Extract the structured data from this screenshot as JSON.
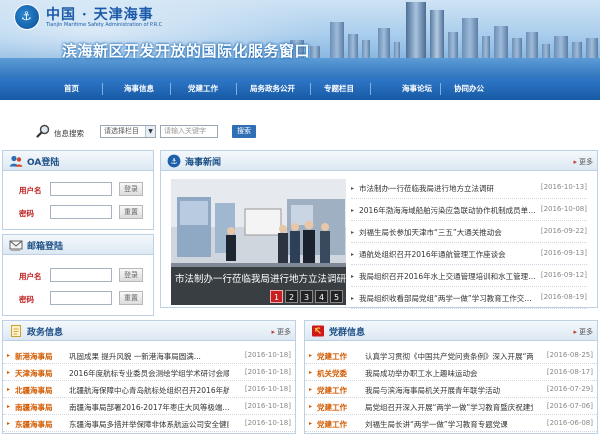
{
  "header": {
    "site_title": "中国 · 天津海事",
    "site_subtitle": "Tianjin Maritime Safety Administration of P.R.C",
    "slogan": "滨海新区开发开放的国际化服务窗口"
  },
  "nav": {
    "items": [
      {
        "label": "首页"
      },
      {
        "label": "海事信息"
      },
      {
        "label": "党建工作"
      },
      {
        "label": "局务政务公开"
      },
      {
        "label": "专题栏目"
      },
      {
        "label": "海事论坛"
      },
      {
        "label": "协同办公"
      }
    ]
  },
  "search": {
    "label": "信息搜索",
    "select_value": "请选择栏目",
    "keyword_placeholder": "请输入关键字",
    "button": "搜索"
  },
  "oa_login": {
    "title": "OA登陆",
    "username_label": "用户名",
    "password_label": "密码",
    "login_button": "登录",
    "reset_button": "重置"
  },
  "mail_login": {
    "title": "邮箱登陆",
    "username_label": "用户名",
    "password_label": "密码",
    "login_button": "登录",
    "reset_button": "重置"
  },
  "news": {
    "title": "海事新闻",
    "more": "更多",
    "slide_caption": "市法制办一行莅临我局进行地方立法调研",
    "pager": [
      "1",
      "2",
      "3",
      "4",
      "5"
    ],
    "pager_active": 1,
    "items": [
      {
        "title": "市法制办一行莅临我局进行地方立法调研",
        "date": "[2016-10-13]"
      },
      {
        "title": "2016年渤海海域船舶污染应急联动协作机制成员单位...",
        "date": "[2016-10-08]"
      },
      {
        "title": "刘福生局长参加天津市“三五”大通关推动会",
        "date": "[2016-09-22]"
      },
      {
        "title": "通航处组织召开2016年通航管理工作座谈会",
        "date": "[2016-09-13]"
      },
      {
        "title": "我局组织召开2016年水上交通管理培训和水工管理技能比...",
        "date": "[2016-09-12]"
      },
      {
        "title": "我局组织收看部局党组“两学一做”学习教育工作交流推...",
        "date": "[2016-08-19]"
      }
    ]
  },
  "gov_info": {
    "title": "政务信息",
    "more": "更多",
    "items": [
      {
        "tag": "新港海事局",
        "title": "巩固成果 提升风貌 一新港海事局圆满...",
        "date": "[2016-10-18]"
      },
      {
        "tag": "天津海事局",
        "title": "2016年度航标专业委员会测绘学组学术研讨会顺利...",
        "date": "[2016-10-18]"
      },
      {
        "tag": "北疆海事局",
        "title": "北疆航海保障中心青岛航标处组织召开2016年航标...",
        "date": "[2016-10-18]"
      },
      {
        "tag": "南疆海事局",
        "title": "南疆海事局部署2016-2017年枣庄大风等极端...",
        "date": "[2016-10-18]"
      },
      {
        "tag": "东疆海事局",
        "title": "东疆海事局多措并举保障非体系航运公司安全健康发展",
        "date": "[2016-10-18]"
      }
    ]
  },
  "party_info": {
    "title": "党群信息",
    "more": "更多",
    "items": [
      {
        "tag": "党建工作",
        "title": "认真学习贯彻《中国共产党问责条例》深入开展“两学...",
        "date": "[2016-08-25]"
      },
      {
        "tag": "机关党委",
        "title": "我局成功举办职工水上趣味运动会",
        "date": "[2016-08-17]"
      },
      {
        "tag": "党建工作",
        "title": "我局与滨海海事局机关开展青年联学活动",
        "date": "[2016-07-29]"
      },
      {
        "tag": "党建工作",
        "title": "局党组召开深入开展“两学一做”学习教育暨庆祝建党...",
        "date": "[2016-07-06]"
      },
      {
        "tag": "党建工作",
        "title": "刘福生局长讲“两学一做”学习教育专题党课",
        "date": "[2016-06-08]"
      }
    ]
  },
  "colors": {
    "nav_blue": "#175aa5",
    "tag_orange": "#d25a00",
    "login_label_red": "#c02020",
    "pager_active": "#c62020"
  }
}
